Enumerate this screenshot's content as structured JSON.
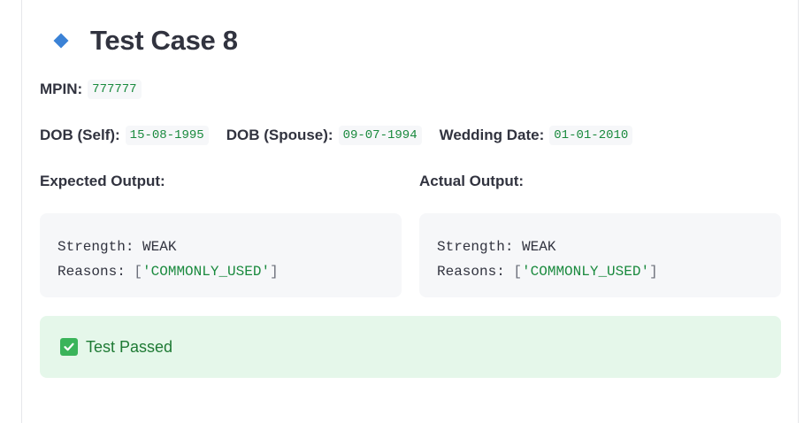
{
  "title": "Test Case 8",
  "mpin": {
    "label": "MPIN:",
    "value": "777777"
  },
  "dob_self": {
    "label": "DOB (Self):",
    "value": "15-08-1995"
  },
  "dob_spouse": {
    "label": "DOB (Spouse):",
    "value": "09-07-1994"
  },
  "wedding": {
    "label": "Wedding Date:",
    "value": "01-01-2010"
  },
  "expected": {
    "label": "Expected Output:",
    "strength_key": "Strength:",
    "strength_value": "WEAK",
    "reasons_key": "Reasons:",
    "reasons_value": "'COMMONLY_USED'"
  },
  "actual": {
    "label": "Actual Output:",
    "strength_key": "Strength:",
    "strength_value": "WEAK",
    "reasons_key": "Reasons:",
    "reasons_value": "'COMMONLY_USED'"
  },
  "status": {
    "text": "Test Passed",
    "icon": "check-box-icon"
  },
  "colors": {
    "accent": "#3b82d6",
    "success_bg": "#e5f7ea",
    "success_text": "#1e7a34",
    "code_green": "#1a8a3e"
  }
}
